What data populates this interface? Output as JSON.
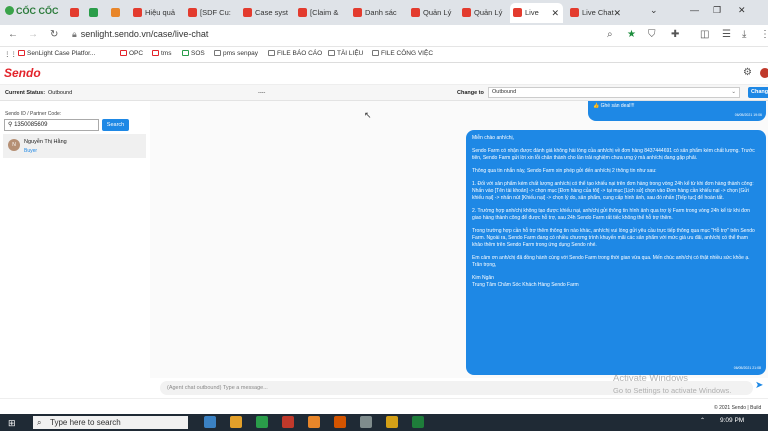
{
  "browser": {
    "brand": "CỐC CỐC",
    "tabs": [
      {
        "label": "",
        "color": "#e33b2e"
      },
      {
        "label": "",
        "color": "#2a9d4a"
      },
      {
        "label": "",
        "color": "#e8862a"
      },
      {
        "label": "Hiệu quả",
        "color": "#e33b2e"
      },
      {
        "label": "[SDF Cu:",
        "color": "#e33b2e"
      },
      {
        "label": "Case syst",
        "color": "#e33b2e"
      },
      {
        "label": "[Claim &",
        "color": "#e33b2e"
      },
      {
        "label": "Danh sác",
        "color": "#e33b2e"
      },
      {
        "label": "Quản Lý",
        "color": "#e33b2e"
      },
      {
        "label": "Quản Lý",
        "color": "#e33b2e"
      },
      {
        "label": "Live",
        "color": "#e33b2e"
      },
      {
        "label": "Live Chat",
        "color": "#e33b2e"
      }
    ],
    "url": "senlight.sendo.vn/case/live-chat",
    "bookmarks": [
      "SenLight Case Platfor...",
      "OPC",
      "tms",
      "SOS",
      "pms senpay",
      "FILE BÁO CÁO",
      "TÀI LIỆU",
      "FILE CÔNG VIỆC"
    ]
  },
  "app": {
    "logo": "Sendo",
    "status_bar": {
      "current_status_label": "Current Status:",
      "current_status_value": "Outbound",
      "middle_value": "----",
      "change_to_label": "Change to",
      "change_to_value": "Outbound",
      "change_button": "Change"
    },
    "left": {
      "id_label": "Sendo ID / Partner Code:",
      "search_value": "1350085609",
      "search_button": "Search",
      "contact": {
        "initial": "N",
        "name": "Nguyễn Thị Hằng",
        "role": "Buyer"
      }
    },
    "chat": {
      "prev_message": "👍 Ghé sàn deal!!!",
      "prev_timestamp": "06/05/2021 19:06",
      "message_paragraphs": [
        "Miễn chào anh/chị,",
        "Sendo Farm có nhận được đánh giá không hài lòng của anh/chị về đơn hàng 8437444691 có sản phẩm kém chất lượng. Trước tiên, Sendo Farm gửi lời xin lỗi chân thành cho lần trải nghiệm chưa ưng ý mà anh/chị đang gặp phải.",
        "Thông qua tin nhắn này, Sendo Farm xin phép gửi đến anh/chị 2 thông tin như sau:",
        "1. Đối với sản phẩm kém chất lượng anh/chị có thể tạo khiếu nại trên đơn hàng trong vòng 24h kể từ khi đơn hàng thành công: Nhấn vào [Tên tài khoản] -> chọn mục [Đơn hàng của tôi] -> tại mục [Lịch sử] chọn vào Đơn hàng cần khiếu nại -> chọn [Gửi khiếu nại] -> nhấn nút [Khiếu nại] -> chọn lý do, sản phẩm, cung cấp hình ảnh, sau đó nhấn [Tiếp tục] để hoàn tất.",
        "2. Trường hợp anh/chị không tạo được khiếu nại, anh/chị gửi thông tin hình ảnh qua trợ lý Farm trong vòng 24h kể từ khi đơn giao hàng thành công để được hỗ trợ, sau 24h Sendo Farm rất tiếc không thể hỗ trợ thêm.",
        "Trong trường hợp cần hỗ trợ thêm thông tin nào khác, anh/chị vui lòng gửi yêu cầu trực tiếp thông qua mục \"Hỗ trợ\" trên Sendo Farm. Ngoài ra, Sendo Farm đang có nhiều chương trình khuyến mãi các sản phẩm với mức giá ưu đãi, anh/chị có thể tham khảo thêm trên Sendo Farm trong ứng dụng Sendo nhé.",
        "Em cảm ơn anh/chị đã đồng hành cùng với Sendo Farm trong thời gian vừa qua. Mến chúc anh/chị có thật nhiều sức khỏe ạ.\nTrân trọng,",
        "Kim Ngân\nTrung Tâm Chăm Sóc Khách Hàng Sendo Farm"
      ],
      "message_timestamp": "06/05/2021 21:08",
      "input_placeholder": "(Agent chat outbound) Type a message..."
    },
    "footer": "© 2021 Sendo | Build"
  },
  "watermark": {
    "line1": "Activate Windows",
    "line2": "Go to Settings to activate Windows."
  },
  "taskbar": {
    "search_placeholder": "Type here to search",
    "time": "9:09 PM"
  },
  "colors": {
    "accent": "#1e88e5",
    "brand": "#e3242b"
  }
}
